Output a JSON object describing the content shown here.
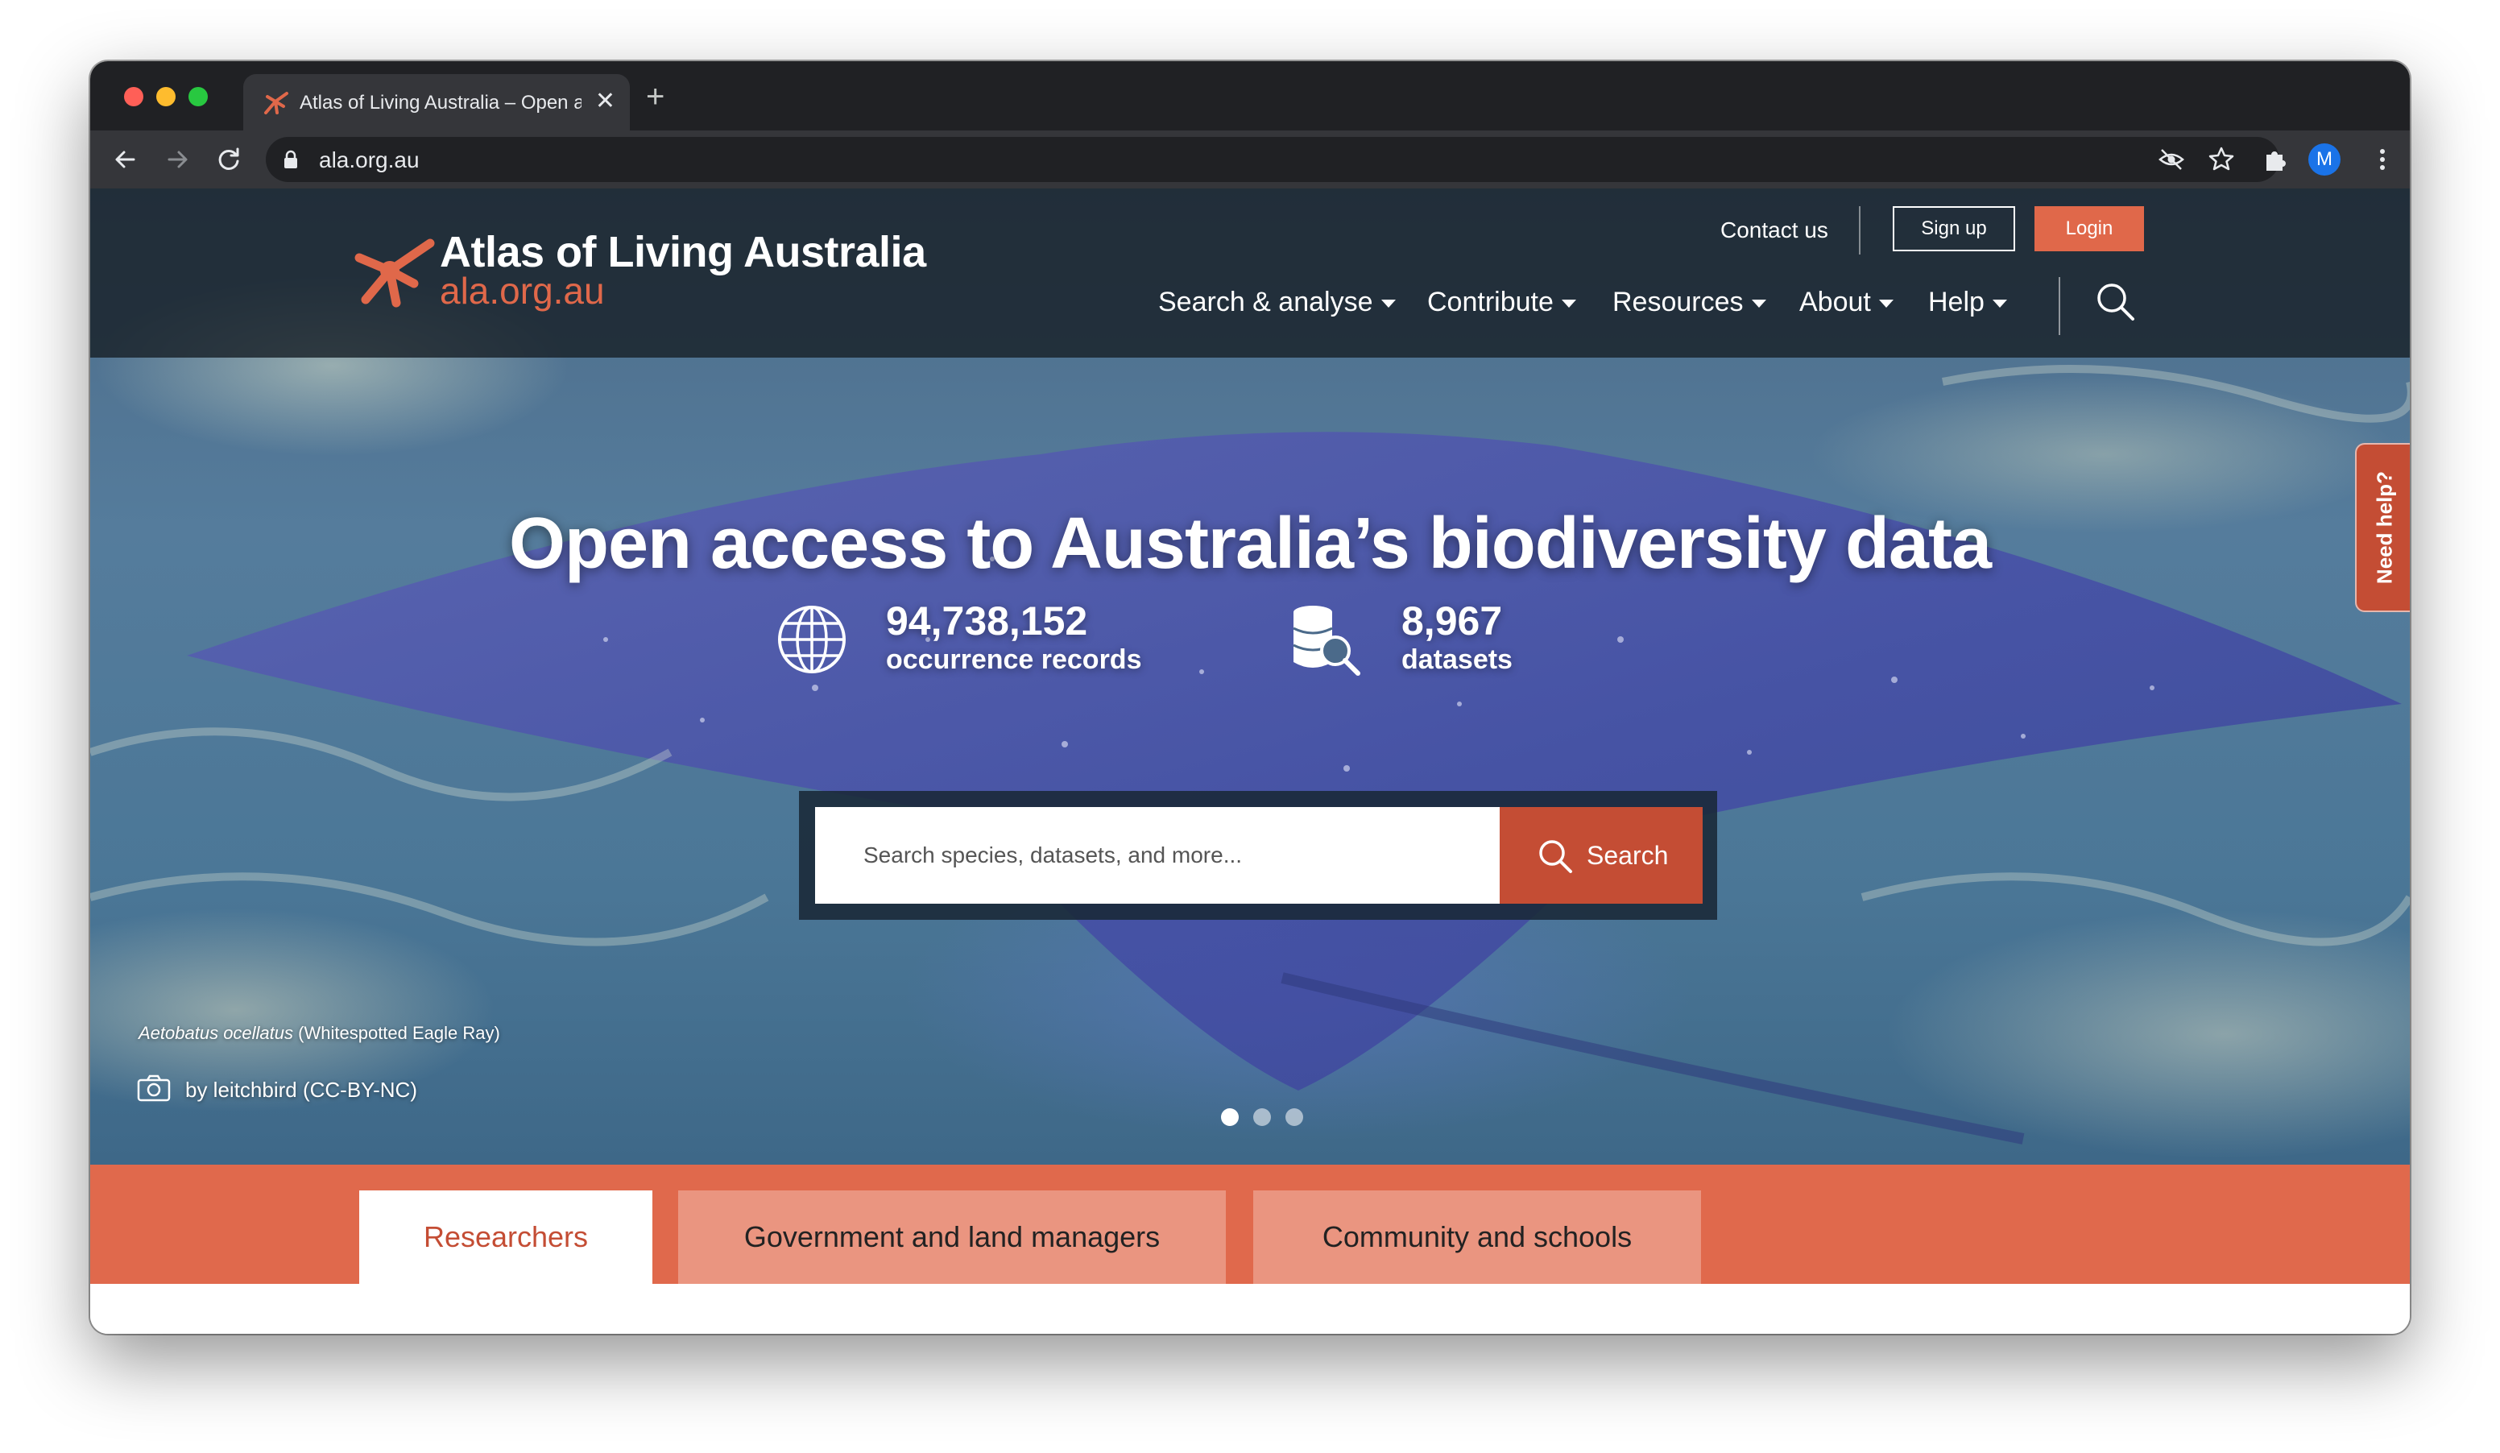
{
  "browser": {
    "tab_title": "Atlas of Living Australia – Open access to Australia’s biodiversity data",
    "new_tab_symbol": "+",
    "close_symbol": "✕",
    "url": "ala.org.au",
    "profile_initial": "M"
  },
  "site": {
    "logo_title": "Atlas of Living Australia",
    "logo_subtitle": "ala.org.au",
    "utility": {
      "contact_label": "Contact us",
      "signup_label": "Sign up",
      "login_label": "Login"
    },
    "nav": {
      "items": [
        {
          "label": "Search & analyse"
        },
        {
          "label": "Contribute"
        },
        {
          "label": "Resources"
        },
        {
          "label": "About"
        },
        {
          "label": "Help"
        }
      ]
    }
  },
  "hero": {
    "title": "Open access to Australia’s biodiversity data",
    "stats": [
      {
        "value": "94,738,152",
        "label": "occurrence records",
        "icon": "globe-icon"
      },
      {
        "value": "8,967",
        "label": "datasets",
        "icon": "database-search-icon"
      }
    ],
    "search": {
      "placeholder": "Search species, datasets, and more...",
      "button_label": "Search"
    },
    "caption": {
      "species_scientific": "Aetobatus ocellatus",
      "species_common": "(Whitespotted Eagle Ray)",
      "credit": "by leitchbird (CC-BY-NC)"
    },
    "carousel": {
      "total": 3,
      "active": 1
    },
    "need_help_label": "Need help?"
  },
  "audience_tabs": [
    {
      "label": "Researchers",
      "active": true
    },
    {
      "label": "Government and land managers",
      "active": false
    },
    {
      "label": "Community and schools",
      "active": false
    }
  ],
  "colors": {
    "brand_orange": "#e0684a",
    "button_red": "#c44d34",
    "chrome_dark": "#202124"
  }
}
